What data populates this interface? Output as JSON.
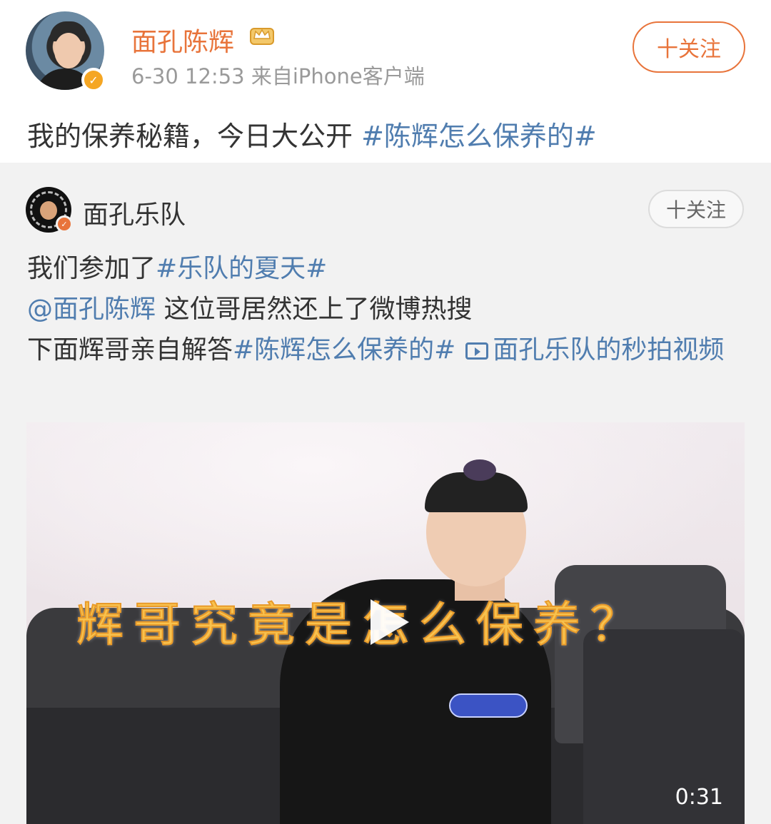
{
  "post": {
    "author_name": "面孔陈辉",
    "meta": "6-30 12:53  来自iPhone客户端",
    "follow_label": "十关注",
    "text_plain": "我的保养秘籍，今日大公开 ",
    "text_topic": "#陈辉怎么保养的#"
  },
  "repost": {
    "author_name": "面孔乐队",
    "follow_label": "十关注",
    "line1_plain": "我们参加了",
    "line1_topic": "#乐队的夏天#",
    "line2_mention": "@面孔陈辉",
    "line2_plain": " 这位哥居然还上了微博热搜",
    "line3_plain": "下面辉哥亲自解答",
    "line3_topic": "#陈辉怎么保养的#",
    "line3_video_link": "面孔乐队的秒拍视频"
  },
  "video": {
    "caption": "辉哥究竟是怎么保养？",
    "duration": "0:31"
  },
  "colors": {
    "accent_orange": "#e8743b",
    "link_blue": "#507daf",
    "repost_bg": "#f2f2f2"
  },
  "icons": [
    "verified-badge-icon",
    "crown-icon",
    "video-link-icon",
    "play-icon"
  ]
}
